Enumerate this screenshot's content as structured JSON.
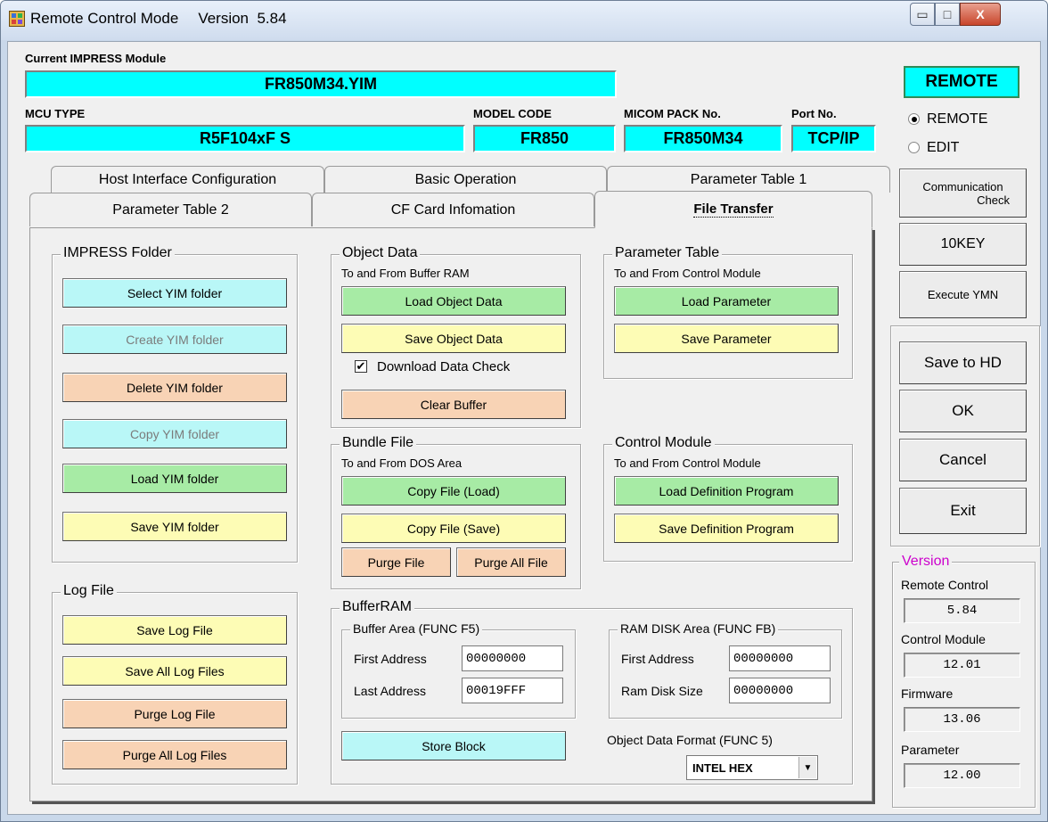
{
  "window": {
    "title": "Remote Control Mode",
    "version_label": "Version  5.84",
    "minimize": "▭",
    "maximize": "□",
    "close": "X"
  },
  "header": {
    "current_module_label": "Current IMPRESS Module",
    "current_module_value": "FR850M34.YIM",
    "mcu_type_label": "MCU TYPE",
    "mcu_type_value": "R5F104xF S",
    "model_code_label": "MODEL CODE",
    "model_code_value": "FR850",
    "micom_pack_label": "MICOM PACK No.",
    "micom_pack_value": "FR850M34",
    "port_label": "Port No.",
    "port_value": "TCP/IP",
    "mode_badge": "REMOTE"
  },
  "mode": {
    "remote_label": "REMOTE",
    "edit_label": "EDIT",
    "selected": "REMOTE"
  },
  "tabs": {
    "row1": [
      "Host Interface Configuration",
      "Basic Operation",
      "Parameter Table 1"
    ],
    "row2": [
      "Parameter Table 2",
      "CF Card Infomation",
      "File Transfer"
    ],
    "active": "File Transfer"
  },
  "impress_folder": {
    "title": "IMPRESS Folder",
    "select": "Select YIM folder",
    "create": "Create YIM folder",
    "delete": "Delete YIM folder",
    "copy": "Copy YIM folder",
    "load": "Load YIM folder",
    "save": "Save YIM folder"
  },
  "log_file": {
    "title": "Log File",
    "save": "Save Log File",
    "save_all": "Save All Log Files",
    "purge": "Purge Log File",
    "purge_all": "Purge All Log Files"
  },
  "object_data": {
    "title": "Object Data",
    "subtitle": "To and From Buffer RAM",
    "load": "Load Object Data",
    "save": "Save Object Data",
    "download_check_label": "Download Data Check",
    "download_check_mark": "✔",
    "clear": "Clear Buffer"
  },
  "parameter_table": {
    "title": "Parameter Table",
    "subtitle": "To and From Control Module",
    "load": "Load Parameter",
    "save": "Save Parameter"
  },
  "bundle_file": {
    "title": "Bundle File",
    "subtitle": "To and From DOS Area",
    "copy_load": "Copy File (Load)",
    "copy_save": "Copy File (Save)",
    "purge": "Purge File",
    "purge_all": "Purge All File"
  },
  "control_module": {
    "title": "Control Module",
    "subtitle": "To and From Control Module",
    "load_def": "Load Definition Program",
    "save_def": "Save Definition Program"
  },
  "buffer_ram": {
    "title": "BufferRAM",
    "buffer_area_title": "Buffer Area (FUNC F5)",
    "first_address_label": "First  Address",
    "first_address_value": "00000000",
    "last_address_label": "Last  Address",
    "last_address_value": "00019FFF",
    "ram_disk_title": "RAM DISK Area (FUNC FB)",
    "ram_first_label": "First  Address",
    "ram_first_value": "00000000",
    "ram_size_label": "Ram Disk Size",
    "ram_size_value": "00000000",
    "store_block": "Store Block",
    "object_format_label": "Object Data Format (FUNC 5)",
    "object_format_value": "INTEL HEX",
    "dropdown_arrow": "▼"
  },
  "right_panel": {
    "comm_check_line1": "Communication",
    "comm_check_line2": "Check",
    "tenkey": "10KEY",
    "execute_ymn": "Execute YMN",
    "save_to_hd": "Save to HD",
    "ok": "OK",
    "cancel": "Cancel",
    "exit": "Exit"
  },
  "version_panel": {
    "title": "Version",
    "remote_control_label": "Remote Control",
    "remote_control_value": "5.84",
    "control_module_label": "Control Module",
    "control_module_value": "12.01",
    "firmware_label": "Firmware",
    "firmware_value": "13.06",
    "parameter_label": "Parameter",
    "parameter_value": "12.00"
  }
}
